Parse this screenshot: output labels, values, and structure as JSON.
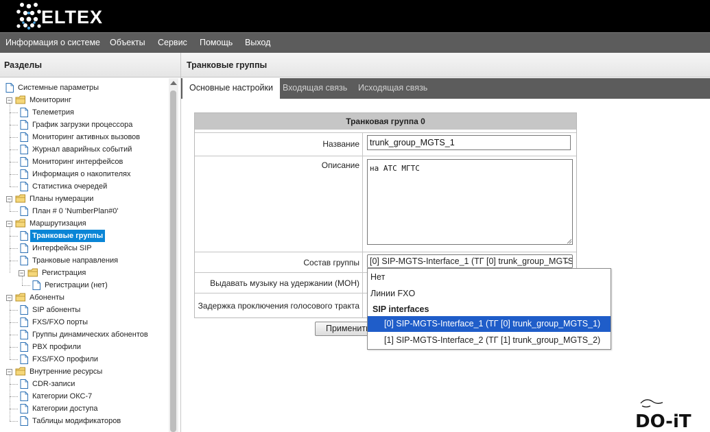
{
  "brand": {
    "logo_text": "ELTEX"
  },
  "menu": [
    "Информация о системе",
    "Объекты",
    "Сервис",
    "Помощь",
    "Выход"
  ],
  "sections": {
    "title": "Разделы",
    "tree": [
      {
        "label": "Системные параметры",
        "level": 0,
        "type": "page"
      },
      {
        "label": "Мониторинг",
        "level": 0,
        "type": "folder"
      },
      {
        "label": "Телеметрия",
        "level": 1,
        "type": "page"
      },
      {
        "label": "График загрузки процессора",
        "level": 1,
        "type": "page"
      },
      {
        "label": "Мониторинг активных вызовов",
        "level": 1,
        "type": "page"
      },
      {
        "label": "Журнал аварийных событий",
        "level": 1,
        "type": "page"
      },
      {
        "label": "Мониторинг интерфейсов",
        "level": 1,
        "type": "page"
      },
      {
        "label": "Информация о накопителях",
        "level": 1,
        "type": "page"
      },
      {
        "label": "Статистика очередей",
        "level": 1,
        "type": "page"
      },
      {
        "label": "Планы нумерации",
        "level": 0,
        "type": "folder"
      },
      {
        "label": "План # 0 'NumberPlan#0'",
        "level": 1,
        "type": "page"
      },
      {
        "label": "Маршрутизация",
        "level": 0,
        "type": "folder"
      },
      {
        "label": "Транковые группы",
        "level": 1,
        "type": "page",
        "selected": true
      },
      {
        "label": "Интерфейсы SIP",
        "level": 1,
        "type": "page"
      },
      {
        "label": "Транковые направления",
        "level": 1,
        "type": "page"
      },
      {
        "label": "Регистрация",
        "level": 1,
        "type": "folder"
      },
      {
        "label": "Регистрации (нет)",
        "level": 2,
        "type": "page"
      },
      {
        "label": "Абоненты",
        "level": 0,
        "type": "folder"
      },
      {
        "label": "SIP абоненты",
        "level": 1,
        "type": "page"
      },
      {
        "label": "FXS/FXO порты",
        "level": 1,
        "type": "page"
      },
      {
        "label": "Группы динамических абонентов",
        "level": 1,
        "type": "page"
      },
      {
        "label": "PBX профили",
        "level": 1,
        "type": "page"
      },
      {
        "label": "FXS/FXO профили",
        "level": 1,
        "type": "page"
      },
      {
        "label": "Внутренние ресурсы",
        "level": 0,
        "type": "folder"
      },
      {
        "label": "CDR-записи",
        "level": 1,
        "type": "page"
      },
      {
        "label": "Категории ОКС-7",
        "level": 1,
        "type": "page"
      },
      {
        "label": "Категории доступа",
        "level": 1,
        "type": "page"
      },
      {
        "label": "Таблицы модификаторов",
        "level": 1,
        "type": "page"
      }
    ]
  },
  "main": {
    "title": "Транковые группы",
    "tabs": [
      "Основные настройки",
      "Входящая связь",
      "Исходящая связь"
    ],
    "active_tab": 0
  },
  "form": {
    "header": "Транковая группа 0",
    "name_label": "Название",
    "name_value": "trunk_group_MGTS_1",
    "desc_label": "Описание",
    "desc_value": "на АТС МГТС",
    "group_label": "Состав группы",
    "group_value": "[0] SIP-MGTS-Interface_1 (ТГ [0] trunk_group_MGTS_1)",
    "moh_label": "Выдавать музыку на удержании (MOH)",
    "delay_label": "Задержка проключения голосового тракта",
    "apply_label": "Применить"
  },
  "dropdown": {
    "options": [
      {
        "label": "Нет",
        "type": "option"
      },
      {
        "label": "Линии FXO",
        "type": "option"
      },
      {
        "label": "SIP interfaces",
        "type": "group"
      },
      {
        "label": "[0] SIP-MGTS-Interface_1 (ТГ [0] trunk_group_MGTS_1)",
        "type": "option",
        "highlighted": true
      },
      {
        "label": "[1] SIP-MGTS-Interface_2 (ТГ [1] trunk_group_MGTS_2)",
        "type": "option"
      }
    ]
  },
  "colors": {
    "header_bg": "#000000",
    "menubar_bg": "#5c5c5c",
    "selected_bg": "#0a85d6",
    "highlight_bg": "#1f5dc9",
    "logo_accent": "#4aa3df"
  }
}
